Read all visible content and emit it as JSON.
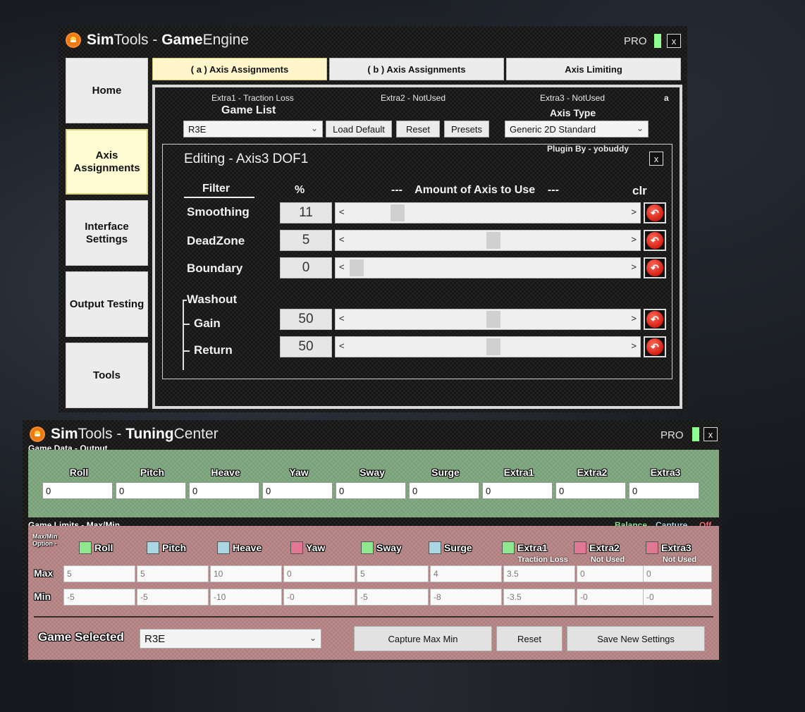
{
  "engine": {
    "title_bold": "Sim",
    "title_rest": "Tools - ",
    "title_bold2": "Game",
    "title_rest2": " Engine",
    "pro": "PRO",
    "close": "x",
    "sidebar": [
      {
        "label": "Home"
      },
      {
        "label": "Axis Assignments",
        "active": true
      },
      {
        "label": "Interface Settings"
      },
      {
        "label": "Output Testing"
      },
      {
        "label": "Tools"
      }
    ],
    "tabs": [
      {
        "label": "( a ) Axis Assignments",
        "active": true
      },
      {
        "label": "( b ) Axis Assignments"
      },
      {
        "label": "Axis Limiting"
      }
    ],
    "extra1": "Extra1 - Traction Loss",
    "extra2": "Extra2 - NotUsed",
    "extra3": "Extra3 - NotUsed",
    "corner_letter": "a",
    "game_list_label": "Game List",
    "game_list_value": "R3E",
    "load_default": "Load Default",
    "reset": "Reset",
    "presets": "Presets",
    "axis_type_label": "Axis Type",
    "axis_type_value": "Generic 2D Standard",
    "plugin_by": "Plugin By - yobuddy",
    "editor": {
      "title": "Editing - Axis3 DOF1",
      "close": "x",
      "filter_hdr": "Filter",
      "pct_hdr": "%",
      "amount_hdr": "---    Amount of Axis to Use    ---",
      "clr_hdr": "clr",
      "washout_lbl": "Washout",
      "rows": [
        {
          "label": "Smoothing",
          "value": "11",
          "level": 0.15
        },
        {
          "label": "DeadZone",
          "value": "5",
          "level": 0.5
        },
        {
          "label": "Boundary",
          "value": "0",
          "level": 0.0
        },
        {
          "label": "Gain",
          "value": "50",
          "level": 0.5
        },
        {
          "label": "Return",
          "value": "50",
          "level": 0.5
        }
      ]
    }
  },
  "tuning": {
    "title_bold": "Sim",
    "title_rest": "Tools - ",
    "title_bold2": "Tuning",
    "title_rest2": " Center",
    "pro": "PRO",
    "close": "x",
    "game_data_label": "Game Data - Output",
    "axes": [
      "Roll",
      "Pitch",
      "Heave",
      "Yaw",
      "Sway",
      "Surge",
      "Extra1",
      "Extra2",
      "Extra3"
    ],
    "outputs": [
      "0",
      "0",
      "0",
      "0",
      "0",
      "0",
      "0",
      "0",
      "0"
    ],
    "game_limits_label": "Game Limits - Max/Min",
    "balance": "Balance",
    "capture": "Capture",
    "off": "Off",
    "maxmin_option_1": "Max/Min",
    "maxmin_option_2": "Option -",
    "option_colors": [
      "#8fe88f",
      "#a9d6e0",
      "#a9d6e0",
      "#e07894",
      "#8fe88f",
      "#a9d6e0",
      "#8fe88f",
      "#e07894",
      "#e07894"
    ],
    "sub_labels": [
      "",
      "",
      "",
      "",
      "",
      "",
      "Traction Loss",
      "Not Used",
      "Not Used"
    ],
    "max_lbl": "Max",
    "min_lbl": "Min",
    "max_values": [
      "5",
      "5",
      "10",
      "0",
      "5",
      "4",
      "3.5",
      "0",
      "0"
    ],
    "min_values": [
      "-5",
      "-5",
      "-10",
      "-0",
      "-5",
      "-8",
      "-3.5",
      "-0",
      "-0"
    ],
    "game_selected_label": "Game Selected",
    "game_selected_value": "R3E",
    "capture_btn": "Capture Max Min",
    "reset_btn": "Reset",
    "save_btn": "Save New Settings"
  }
}
